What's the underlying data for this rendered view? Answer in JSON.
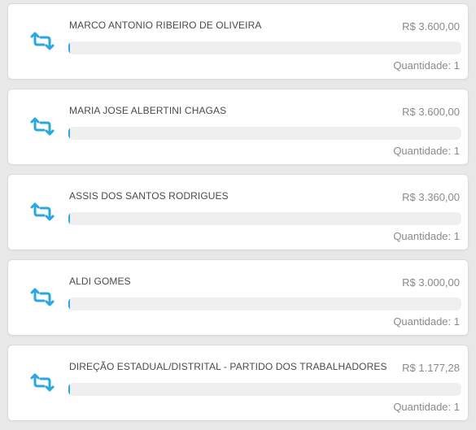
{
  "items": [
    {
      "name": "MARCO ANTONIO RIBEIRO DE OLIVEIRA",
      "amount": "R$ 3.600,00",
      "quantity_label": "Quantidade: 1",
      "progress": 0.004,
      "icon": "retweet-icon"
    },
    {
      "name": "MARIA JOSE ALBERTINI CHAGAS",
      "amount": "R$ 3.600,00",
      "quantity_label": "Quantidade: 1",
      "progress": 0.004,
      "icon": "retweet-icon"
    },
    {
      "name": "ASSIS DOS SANTOS RODRIGUES",
      "amount": "R$ 3.360,00",
      "quantity_label": "Quantidade: 1",
      "progress": 0.004,
      "icon": "retweet-icon"
    },
    {
      "name": "ALDI GOMES",
      "amount": "R$ 3.000,00",
      "quantity_label": "Quantidade: 1",
      "progress": 0.004,
      "icon": "retweet-icon"
    },
    {
      "name": "DIREÇÃO ESTADUAL/DISTRITAL - PARTIDO DOS TRABALHADORES",
      "amount": "R$ 1.177,28",
      "quantity_label": "Quantidade: 1",
      "progress": 0.002,
      "icon": "retweet-icon"
    }
  ],
  "colors": {
    "accent": "#2aa7e0",
    "card_bg": "#ffffff",
    "page_bg": "#e8e8e8",
    "track_bg": "#efefef",
    "name_text": "#4a4a4a",
    "muted_text": "#8a8a8a"
  }
}
